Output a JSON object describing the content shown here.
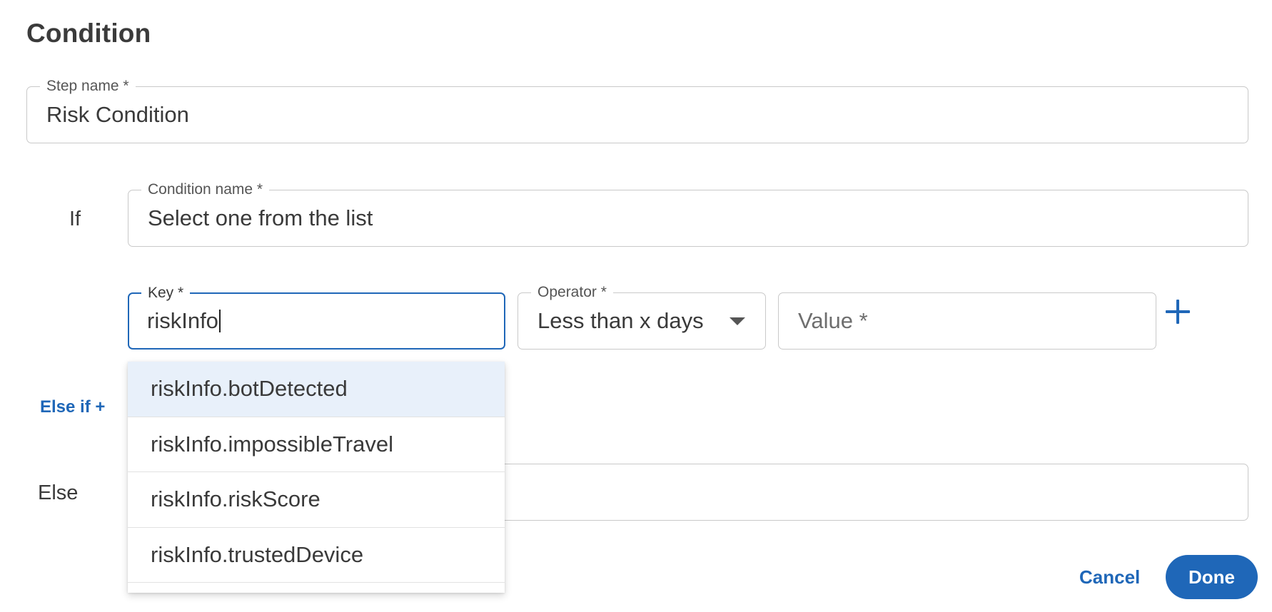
{
  "header": {
    "title": "Condition"
  },
  "step_name": {
    "label": "Step name *",
    "value": "Risk Condition"
  },
  "if_block": {
    "label": "If",
    "condition_name": {
      "label": "Condition name *",
      "value": "Select one from the list"
    },
    "key": {
      "label": "Key *",
      "value": "riskInfo"
    },
    "operator": {
      "label": "Operator *",
      "value": "Less than x days"
    },
    "value_field": {
      "placeholder": "Value *"
    }
  },
  "else_if": {
    "label": "Else if +"
  },
  "else_block": {
    "label": "Else"
  },
  "key_suggestions": [
    {
      "label": "riskInfo.botDetected",
      "highlighted": true
    },
    {
      "label": "riskInfo.impossibleTravel",
      "highlighted": false
    },
    {
      "label": "riskInfo.riskScore",
      "highlighted": false
    },
    {
      "label": "riskInfo.trustedDevice",
      "highlighted": false
    }
  ],
  "footer": {
    "cancel_label": "Cancel",
    "done_label": "Done"
  },
  "icons": {
    "add_row": "plus-icon",
    "operator_dropdown": "triangle-down-icon"
  },
  "colors": {
    "accent": "#1f67b8",
    "highlight": "#e8f0fa",
    "border": "#c9c9c9",
    "text": "#3a3a3a"
  }
}
